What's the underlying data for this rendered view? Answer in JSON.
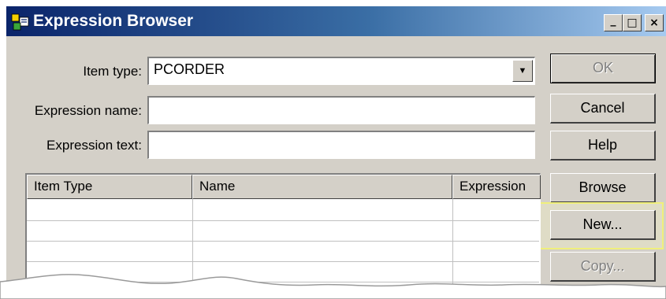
{
  "window": {
    "title": "Expression Browser",
    "controls": {
      "minimize": "_",
      "maximize": "□",
      "close": "×"
    }
  },
  "form": {
    "item_type_label": "Item type:",
    "item_type_value": "PCORDER",
    "expression_name_label": "Expression name:",
    "expression_name_value": "",
    "expression_text_label": "Expression text:",
    "expression_text_value": ""
  },
  "buttons": {
    "ok": "OK",
    "cancel": "Cancel",
    "help": "Help",
    "browse": "Browse",
    "new": "New...",
    "copy": "Copy..."
  },
  "grid": {
    "columns": [
      "Item Type",
      "Name",
      "Expression"
    ],
    "rows": []
  },
  "colors": {
    "titlebar_start": "#0a246a",
    "titlebar_end": "#a6caf0",
    "face": "#d4d0c8",
    "highlight_box": "#f0f07a"
  }
}
